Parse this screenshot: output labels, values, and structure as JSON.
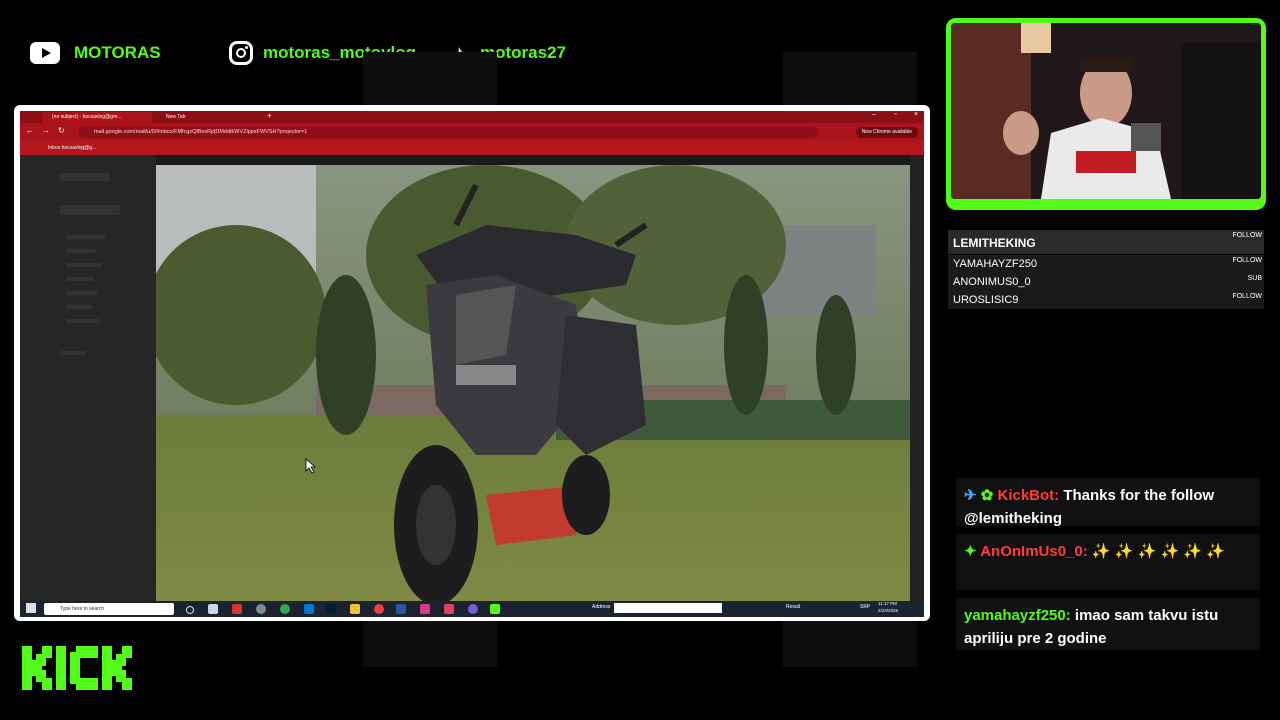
{
  "socials": {
    "youtube": "MOTORAS",
    "instagram": "motoras_motovlog",
    "tiktok": "motoras27"
  },
  "browser": {
    "tabs": [
      "(no subject) - hocsavlog@gm...",
      "New Tab"
    ],
    "url": "mail.google.com/mail/u/0/#inbox/FMfcgzQfBsvRjdDMddtkWVZlppxFWVSH?projector=1",
    "new_chrome_badge": "New Chrome available",
    "bookmark": "Inbox hocsavlog@g..."
  },
  "taskbar": {
    "search_placeholder": "Type here to search",
    "address_label": "Address",
    "result_label": "Result",
    "lang": "SRP",
    "time": "11:17 PM",
    "date": "2/23/2025"
  },
  "follow_panel": {
    "rows": [
      {
        "name": "LEMITHEKING",
        "type": "FOLLOW"
      },
      {
        "name": "YAMAHAYZF250",
        "type": "FOLLOW"
      },
      {
        "name": "ANONIMUS0_0",
        "type": "SUB"
      },
      {
        "name": "UROSLISIC9",
        "type": "FOLLOW"
      }
    ]
  },
  "chat": {
    "messages": [
      {
        "user": "KickBot:",
        "text": "Thanks for the follow @lemitheking"
      },
      {
        "user": "AnOnImUs0_0:",
        "text": ""
      },
      {
        "user": "yamahayzf250:",
        "text": "imao sam takvu istu apriliju pre 2 godine"
      }
    ]
  },
  "brand": {
    "logo": "KICK",
    "accent": "#53fc18"
  },
  "colors": {
    "chrome_red": "#a8141a",
    "kick_green": "#53fc18"
  }
}
